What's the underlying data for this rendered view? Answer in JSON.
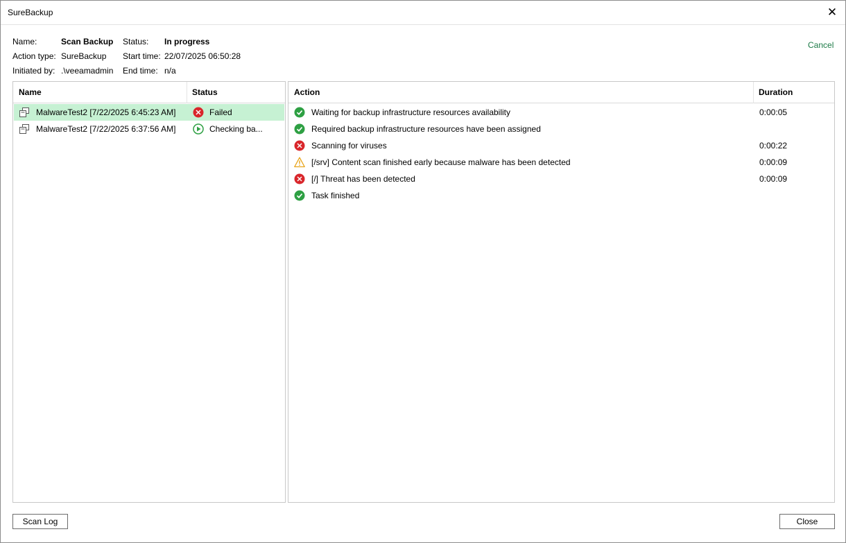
{
  "window": {
    "title": "SureBackup"
  },
  "info": {
    "name_label": "Name:",
    "name_value": "Scan Backup",
    "action_type_label": "Action type:",
    "action_type_value": "SureBackup",
    "initiated_by_label": "Initiated by:",
    "initiated_by_value": ".\\veeamadmin",
    "status_label": "Status:",
    "status_value": "In progress",
    "start_time_label": "Start time:",
    "start_time_value": "22/07/2025 06:50:28",
    "end_time_label": "End time:",
    "end_time_value": "n/a"
  },
  "cancel_label": "Cancel",
  "tasks": {
    "headers": {
      "name": "Name",
      "status": "Status"
    },
    "rows": [
      {
        "name": "MalwareTest2 [7/22/2025 6:45:23 AM]",
        "status": "Failed",
        "status_icon": "error-icon",
        "selected": true
      },
      {
        "name": "MalwareTest2 [7/22/2025 6:37:56 AM]",
        "status": "Checking ba...",
        "status_icon": "running-icon",
        "selected": false
      }
    ]
  },
  "actions": {
    "headers": {
      "action": "Action",
      "duration": "Duration"
    },
    "rows": [
      {
        "text": "Waiting for backup infrastructure resources availability",
        "duration": "0:00:05",
        "icon": "success-icon"
      },
      {
        "text": "Required backup infrastructure resources have been assigned",
        "duration": "",
        "icon": "success-icon"
      },
      {
        "text": "Scanning for viruses",
        "duration": "0:00:22",
        "icon": "error-icon"
      },
      {
        "text": "[/srv] Content scan finished early because malware has been detected",
        "duration": "0:00:09",
        "icon": "warning-icon"
      },
      {
        "text": "[/] Threat has been detected",
        "duration": "0:00:09",
        "icon": "error-icon"
      },
      {
        "text": "Task finished",
        "duration": "",
        "icon": "success-icon"
      }
    ]
  },
  "buttons": {
    "scan_log": "Scan Log",
    "close": "Close"
  },
  "colors": {
    "success": "#2ea043",
    "error": "#d9262b",
    "warning": "#e8a317",
    "selected_row": "#c6f1d3",
    "link": "#1c7a46"
  }
}
